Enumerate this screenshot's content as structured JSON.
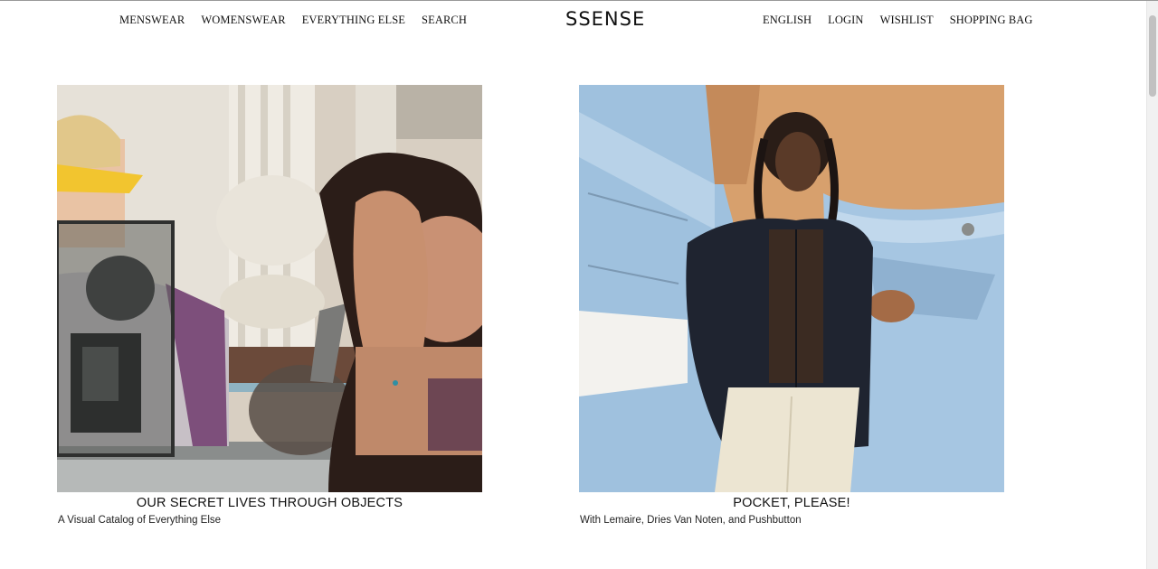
{
  "header": {
    "nav_left": [
      "MENSWEAR",
      "WOMENSWEAR",
      "EVERYTHING ELSE",
      "SEARCH"
    ],
    "logo": "SSENSE",
    "nav_right": [
      "ENGLISH",
      "LOGIN",
      "WISHLIST",
      "SHOPPING BAG"
    ]
  },
  "features": [
    {
      "title": "OUR SECRET LIVES THROUGH OBJECTS",
      "subtitle": "A Visual Catalog of Everything Else"
    },
    {
      "title": "POCKET, PLEASE!",
      "subtitle": "With Lemaire, Dries Van Noten, and Pushbutton"
    }
  ],
  "colors": {
    "background": "#ffffff",
    "text": "#111111"
  }
}
